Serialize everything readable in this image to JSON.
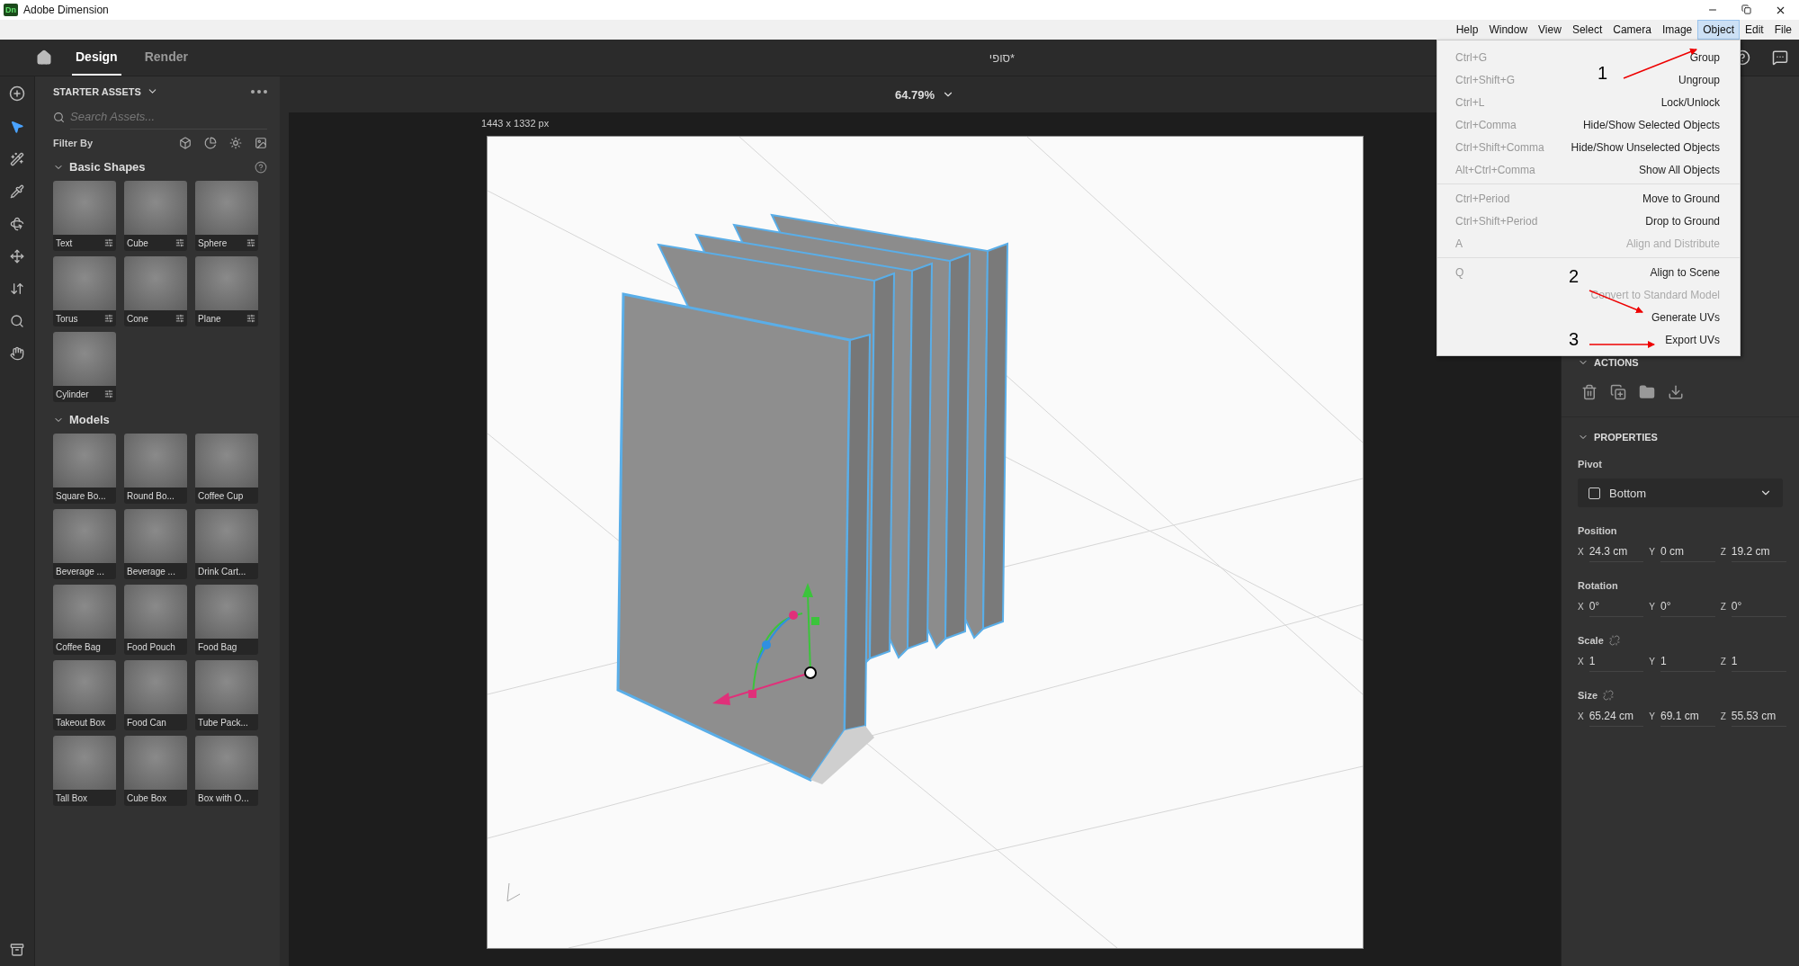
{
  "window": {
    "logo": "Dn",
    "title": "Adobe Dimension"
  },
  "menu_bar": [
    {
      "label": "Help",
      "selected": false
    },
    {
      "label": "Window",
      "selected": false
    },
    {
      "label": "View",
      "selected": false
    },
    {
      "label": "Select",
      "selected": false
    },
    {
      "label": "Camera",
      "selected": false
    },
    {
      "label": "Image",
      "selected": false
    },
    {
      "label": "Object",
      "selected": true
    },
    {
      "label": "Edit",
      "selected": false
    },
    {
      "label": "File",
      "selected": false
    }
  ],
  "app_tabs": [
    {
      "label": "Design",
      "selected": true
    },
    {
      "label": "Render",
      "selected": false
    }
  ],
  "document_title": "סופי*",
  "assets": {
    "title": "STARTER ASSETS",
    "search": {
      "placeholder": "Search Assets..."
    },
    "filter_label": "Filter By",
    "sections": [
      {
        "title": "Basic Shapes",
        "kind": "shapes",
        "expanded": true,
        "items": [
          {
            "label": "Text"
          },
          {
            "label": "Cube"
          },
          {
            "label": "Sphere"
          },
          {
            "label": "Torus"
          },
          {
            "label": "Cone"
          },
          {
            "label": "Plane"
          },
          {
            "label": "Cylinder"
          }
        ]
      },
      {
        "title": "Models",
        "kind": "models",
        "expanded": true,
        "items": [
          {
            "label": "Square Bo..."
          },
          {
            "label": "Round Bo..."
          },
          {
            "label": "Coffee Cup"
          },
          {
            "label": "Beverage ..."
          },
          {
            "label": "Beverage ..."
          },
          {
            "label": "Drink Cart..."
          },
          {
            "label": "Coffee Bag"
          },
          {
            "label": "Food Pouch"
          },
          {
            "label": "Food Bag"
          },
          {
            "label": "Takeout Box"
          },
          {
            "label": "Food Can"
          },
          {
            "label": "Tube Pack..."
          },
          {
            "label": "Tall Box"
          },
          {
            "label": "Cube Box"
          },
          {
            "label": "Box with O..."
          }
        ]
      }
    ]
  },
  "canvas": {
    "zoom": "64.79%",
    "size_label": "1443 x 1332 px"
  },
  "object_menu": {
    "groups": [
      {
        "items": [
          {
            "shortcut": "Ctrl+G",
            "label": "Group",
            "disabled": false
          },
          {
            "shortcut": "Ctrl+Shift+G",
            "label": "Ungroup",
            "disabled": false
          },
          {
            "shortcut": "Ctrl+L",
            "label": "Lock/Unlock",
            "disabled": false
          },
          {
            "shortcut": "Ctrl+Comma",
            "label": "Hide/Show Selected Objects",
            "disabled": false
          },
          {
            "shortcut": "Ctrl+Shift+Comma",
            "label": "Hide/Show Unselected Objects",
            "disabled": false
          },
          {
            "shortcut": "Alt+Ctrl+Comma",
            "label": "Show All Objects",
            "disabled": false
          }
        ]
      },
      {
        "items": [
          {
            "shortcut": "Ctrl+Period",
            "label": "Move to Ground",
            "disabled": false
          },
          {
            "shortcut": "Ctrl+Shift+Period",
            "label": "Drop to Ground",
            "disabled": false
          },
          {
            "shortcut": "A",
            "label": "Align and Distribute",
            "disabled": true
          }
        ]
      },
      {
        "items": [
          {
            "shortcut": "Q",
            "label": "Align to Scene",
            "disabled": false
          },
          {
            "label": "Convert to Standard Model",
            "disabled": true
          },
          {
            "label": "Generate UVs",
            "disabled": false
          },
          {
            "label": "Export UVs",
            "disabled": false
          }
        ]
      }
    ]
  },
  "annotations": [
    {
      "label": "1"
    },
    {
      "label": "2"
    },
    {
      "label": "3"
    }
  ],
  "actions": {
    "title": "ACTIONS",
    "expanded": true
  },
  "properties": {
    "title": "PROPERTIES",
    "expanded": true,
    "pivot": {
      "label": "Pivot",
      "value": "Bottom"
    },
    "groups": [
      {
        "label": "Position",
        "link_toggle": false,
        "fields": [
          {
            "axis": "X",
            "value": "24.3 cm"
          },
          {
            "axis": "Y",
            "value": "0 cm"
          },
          {
            "axis": "Z",
            "value": "19.2 cm"
          }
        ]
      },
      {
        "label": "Rotation",
        "link_toggle": false,
        "fields": [
          {
            "axis": "X",
            "value": "0°"
          },
          {
            "axis": "Y",
            "value": "0°"
          },
          {
            "axis": "Z",
            "value": "0°"
          }
        ]
      },
      {
        "label": "Scale",
        "link_toggle": true,
        "fields": [
          {
            "axis": "X",
            "value": "1"
          },
          {
            "axis": "Y",
            "value": "1"
          },
          {
            "axis": "Z",
            "value": "1"
          }
        ]
      },
      {
        "label": "Size",
        "link_toggle": true,
        "fields": [
          {
            "axis": "X",
            "value": "65.24 cm"
          },
          {
            "axis": "Y",
            "value": "69.1 cm"
          },
          {
            "axis": "Z",
            "value": "55.53 cm"
          }
        ]
      }
    ]
  }
}
